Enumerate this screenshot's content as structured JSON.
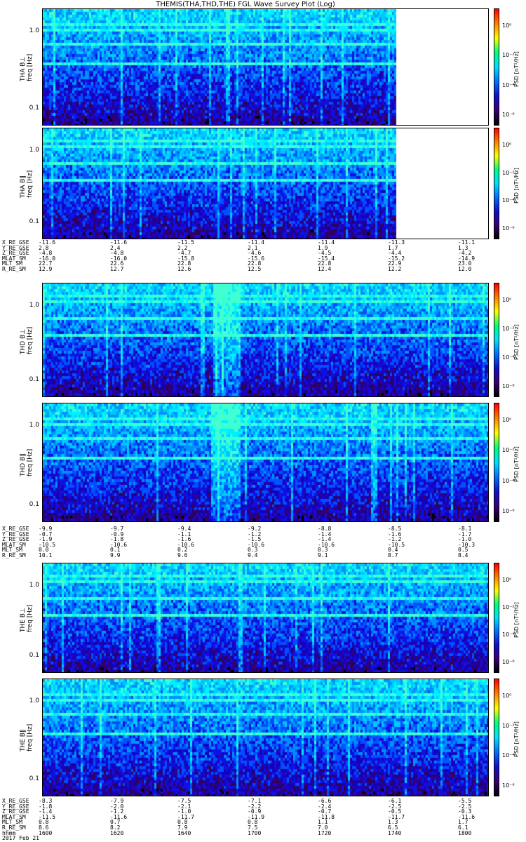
{
  "title": "THEMIS(THA,THD,THE) FGL Wave Survey Plot (Log)",
  "colors": {
    "colorbar": [
      "#000000",
      "#3a0070",
      "#1010c8",
      "#0070ff",
      "#00e0ff",
      "#00ff80",
      "#ffff00",
      "#ff8000",
      "#ff0000"
    ]
  },
  "chart_data": [
    {
      "type": "heatmap",
      "probe": "THA",
      "ylabel_top": "THA B⊥",
      "ylabel_bottom": "freq [Hz]",
      "yscale": "log",
      "yticks": [
        "1.0",
        "0.1"
      ],
      "colorbar_label": "PSD [nT²/Hz]",
      "colorbar_ticks": [
        "10⁰",
        "10⁻²",
        "10⁻⁴",
        "10⁻⁶"
      ],
      "data_coverage": 0.79
    },
    {
      "type": "heatmap",
      "probe": "THA",
      "ylabel_top": "THA B∥",
      "ylabel_bottom": "freq [Hz]",
      "yscale": "log",
      "yticks": [
        "1.0",
        "0.1"
      ],
      "colorbar_label": "PSD [nT²/Hz]",
      "colorbar_ticks": [
        "10⁰",
        "10⁻²",
        "10⁻⁴",
        "10⁻⁶"
      ],
      "data_coverage": 0.79
    },
    {
      "type": "heatmap",
      "probe": "THD",
      "ylabel_top": "THD B⊥",
      "ylabel_bottom": "freq [Hz]",
      "yscale": "log",
      "yticks": [
        "1.0",
        "0.1"
      ],
      "colorbar_label": "PSD [nT²/Hz]",
      "colorbar_ticks": [
        "10⁰",
        "10⁻²",
        "10⁻⁴",
        "10⁻⁶"
      ],
      "data_coverage": 1.0
    },
    {
      "type": "heatmap",
      "probe": "THD",
      "ylabel_top": "THD B∥",
      "ylabel_bottom": "freq [Hz]",
      "yscale": "log",
      "yticks": [
        "1.0",
        "0.1"
      ],
      "colorbar_label": "PSD [nT²/Hz]",
      "colorbar_ticks": [
        "10⁰",
        "10⁻²",
        "10⁻⁴",
        "10⁻⁶"
      ],
      "data_coverage": 1.0
    },
    {
      "type": "heatmap",
      "probe": "THE",
      "ylabel_top": "THE B⊥",
      "ylabel_bottom": "freq [Hz]",
      "yscale": "log",
      "yticks": [
        "1.0",
        "0.1"
      ],
      "colorbar_label": "PSD [nT²/Hz]",
      "colorbar_ticks": [
        "10⁰",
        "10⁻²",
        "10⁻⁴",
        "10⁻⁶"
      ],
      "data_coverage": 1.0
    },
    {
      "type": "heatmap",
      "probe": "THE",
      "ylabel_top": "THE B∥",
      "ylabel_bottom": "freq [Hz]",
      "yscale": "log",
      "yticks": [
        "1.0",
        "0.1"
      ],
      "colorbar_label": "PSD [nT²/Hz]",
      "colorbar_ticks": [
        "10⁰",
        "10⁻²",
        "10⁻⁴",
        "10⁻⁶"
      ],
      "data_coverage": 1.0
    }
  ],
  "ephemeris": [
    {
      "rows": [
        {
          "label": "X_RE_GSE",
          "values": [
            "-11.6",
            "-11.6",
            "-11.5",
            "-11.4",
            "-11.4",
            "-11.3",
            "-11.1"
          ]
        },
        {
          "label": "Y_RE_GSE",
          "values": [
            "2.8",
            "2.4",
            "2.2",
            "2.1",
            "1.9",
            "1.7",
            "1.3"
          ]
        },
        {
          "label": "Z_RE_GSE",
          "values": [
            "-4.8",
            "-4.8",
            "-4.7",
            "-4.6",
            "-4.5",
            "-4.4",
            "-4.2"
          ]
        },
        {
          "label": "MLAT_SM",
          "values": [
            "-16.0",
            "-16.0",
            "-15.8",
            "-15.6",
            "-15.4",
            "-15.2",
            "-14.9"
          ]
        },
        {
          "label": "MLT_SM",
          "values": [
            "22.7",
            "22.6",
            "22.8",
            "22.8",
            "22.8",
            "22.9",
            "23.0"
          ]
        },
        {
          "label": "R_RE_SM",
          "values": [
            "12.9",
            "12.7",
            "12.6",
            "12.5",
            "12.4",
            "12.2",
            "12.0"
          ]
        }
      ]
    },
    {
      "rows": [
        {
          "label": "X_RE_GSE",
          "values": [
            "-9.9",
            "-9.7",
            "-9.4",
            "-9.2",
            "-8.8",
            "-8.5",
            "-8.1"
          ]
        },
        {
          "label": "Y_RE_GSE",
          "values": [
            "-0.7",
            "-0.9",
            "-1.1",
            "-1.2",
            "-1.4",
            "-1.6",
            "-1.7"
          ]
        },
        {
          "label": "Z_RE_GSE",
          "values": [
            "-1.9",
            "-1.8",
            "-1.6",
            "-1.5",
            "-1.4",
            "-1.2",
            "-1.0"
          ]
        },
        {
          "label": "MLAT_SM",
          "values": [
            "-10.5",
            "-10.6",
            "-10.6",
            "-10.6",
            "-10.6",
            "-10.5",
            "-10.3"
          ]
        },
        {
          "label": "MLT_SM",
          "values": [
            "0.0",
            "0.1",
            "0.2",
            "0.3",
            "0.3",
            "0.4",
            "0.5"
          ]
        },
        {
          "label": "R_RE_SM",
          "values": [
            "10.1",
            "9.9",
            "9.6",
            "9.4",
            "9.1",
            "8.7",
            "8.4"
          ]
        }
      ]
    },
    {
      "rows": [
        {
          "label": "X_RE_GSE",
          "values": [
            "-8.3",
            "-7.9",
            "-7.5",
            "-7.1",
            "-6.6",
            "-6.1",
            "-5.5"
          ]
        },
        {
          "label": "Y_RE_GSE",
          "values": [
            "-1.8",
            "-2.0",
            "-2.1",
            "-2.2",
            "-2.4",
            "-2.5",
            "-2.5"
          ]
        },
        {
          "label": "Z_RE_GSE",
          "values": [
            "-1.4",
            "-1.2",
            "-1.0",
            "-0.9",
            "-0.7",
            "-0.5",
            "-0.3"
          ]
        },
        {
          "label": "MLAT_SM",
          "values": [
            "-11.5",
            "-11.6",
            "-11.7",
            "-11.9",
            "-11.8",
            "-11.7",
            "-11.6"
          ]
        },
        {
          "label": "MLT_SM",
          "values": [
            "0.8",
            "0.7",
            "0.8",
            "0.8",
            "1.1",
            "1.3",
            "1.7"
          ]
        },
        {
          "label": "R_RE_SM",
          "values": [
            "8.6",
            "8.2",
            "7.9",
            "7.5",
            "7.0",
            "6.5",
            "6.1"
          ]
        },
        {
          "label": "hhmm",
          "values": [
            "1600",
            "1620",
            "1640",
            "1700",
            "1720",
            "1740",
            "1800"
          ]
        },
        {
          "label": "2017 Feb 21",
          "values": []
        }
      ]
    }
  ]
}
